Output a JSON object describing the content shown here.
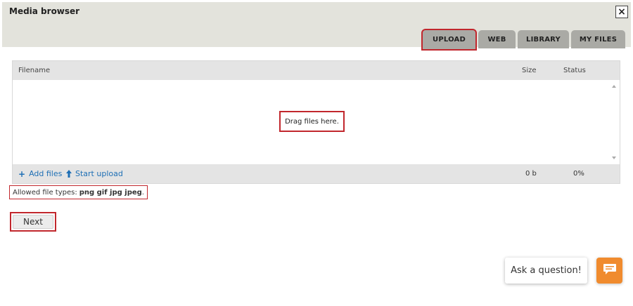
{
  "dialog": {
    "title": "Media browser",
    "close_label": "×"
  },
  "tabs": [
    {
      "label": "UPLOAD",
      "active": true
    },
    {
      "label": "WEB",
      "active": false
    },
    {
      "label": "LIBRARY",
      "active": false
    },
    {
      "label": "MY FILES",
      "active": false
    }
  ],
  "file_list": {
    "columns": {
      "filename": "Filename",
      "size": "Size",
      "status": "Status"
    },
    "drop_text": "Drag files here.",
    "add_files_label": "Add files",
    "start_upload_label": "Start upload",
    "total_size": "0 b",
    "total_status": "0%"
  },
  "allowed": {
    "label": "Allowed file types:",
    "types": "png gif jpg jpeg",
    "suffix": "."
  },
  "next_button_label": "Next",
  "chat": {
    "prompt": "Ask a question!",
    "icon": "chat-bubble-icon",
    "color": "#f08b2e"
  },
  "colors": {
    "highlight": "#c1272d",
    "link": "#1e6fb5",
    "tab_bg": "#aaaaa5",
    "header_bg": "#e3e3dc"
  }
}
